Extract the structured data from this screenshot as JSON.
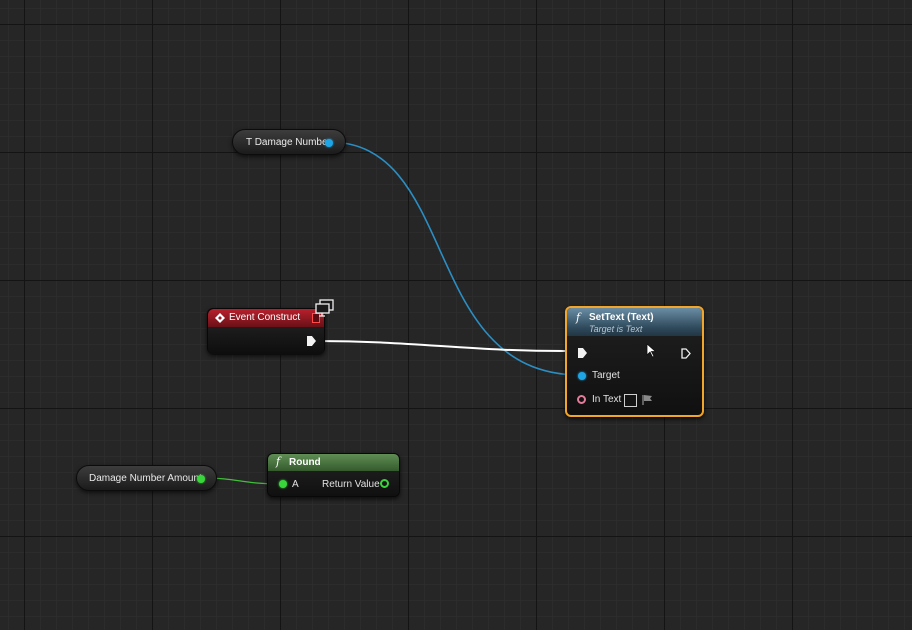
{
  "graph": {
    "wire_colors": {
      "object": "#2b8ec3",
      "exec": "#ffffff",
      "float": "#3fbf3a"
    }
  },
  "var_t_damage_number": {
    "label": "T Damage Number",
    "pin_color": "#1ea5e6"
  },
  "event_construct": {
    "title": "Event Construct",
    "header_color": "#9b1c26",
    "icon": "event-diamond-icon",
    "badge_icon": "monitor-icon"
  },
  "settext": {
    "title": "SetText (Text)",
    "subtitle": "Target is Text",
    "icon": "function-icon",
    "selected_border_color": "#f1a52a",
    "pins": {
      "target_label": "Target",
      "in_text_label": "In Text"
    }
  },
  "var_damage_number_amount": {
    "label": "Damage Number Amount",
    "pin_color": "#39d63b"
  },
  "round": {
    "title": "Round",
    "icon": "function-icon",
    "header_color": "#4a7a40",
    "pins": {
      "a_label": "A",
      "return_label": "Return Value"
    }
  }
}
